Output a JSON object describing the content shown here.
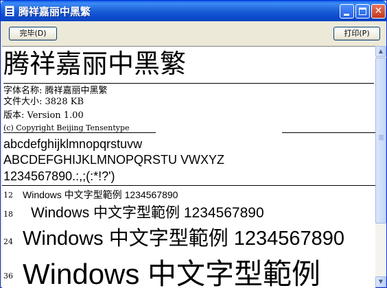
{
  "window": {
    "title": "腾祥嘉丽中黑繁",
    "minimize_glyph": "",
    "maximize_glyph": "",
    "close_glyph": "✕"
  },
  "toolbar": {
    "done_label": "完毕(D)",
    "print_label": "打印(P)"
  },
  "preview": {
    "font_display_name": "腾祥嘉丽中黑繁",
    "info": {
      "name_line": "字体名称: 腾祥嘉丽中黑繁",
      "size_line": "文件大小: 3828 KB",
      "version_line": "版本: Version  1.00",
      "copyright_line": "(c) Copyright Beijing Tensentype"
    },
    "samples": {
      "lowercase": "abcdefghijklmnopqrstuvw",
      "uppercase": "ABCDEFGHIJKLMNOPQRSTU  VWXYZ",
      "digits": "1234567890.:,;(:*!?')"
    },
    "size_samples": [
      {
        "size": "12",
        "text": "Windows  中文字型範例  1234567890"
      },
      {
        "size": "18",
        "text": "Windows  中文字型範例  1234567890"
      },
      {
        "size": "24",
        "text": "Windows  中文字型範例  1234567890"
      },
      {
        "size": "36",
        "text": "Windows  中文字型範例"
      }
    ]
  },
  "scrollbar": {
    "up_glyph": "▲",
    "down_glyph": "▼"
  }
}
